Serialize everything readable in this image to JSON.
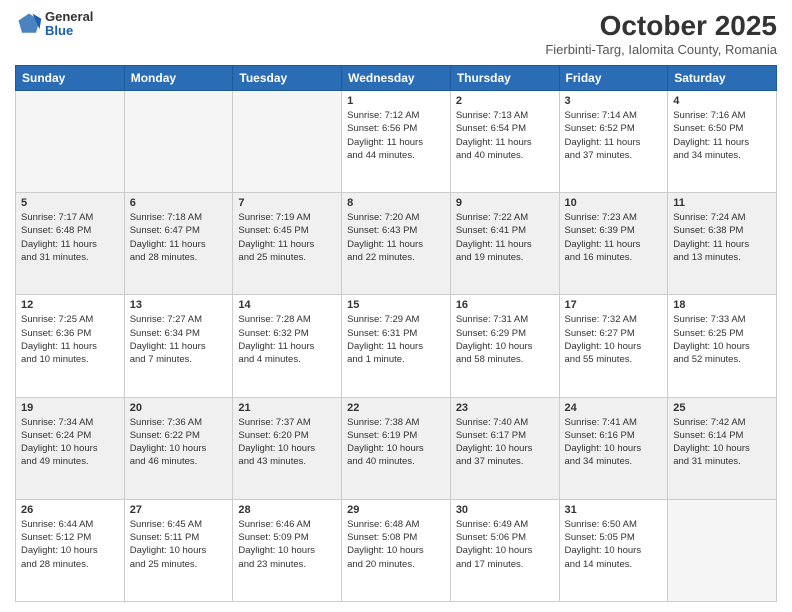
{
  "header": {
    "logo": {
      "line1": "General",
      "line2": "Blue"
    },
    "title": "October 2025",
    "location": "Fierbinti-Targ, Ialomita County, Romania"
  },
  "weekdays": [
    "Sunday",
    "Monday",
    "Tuesday",
    "Wednesday",
    "Thursday",
    "Friday",
    "Saturday"
  ],
  "rows": [
    {
      "shaded": false,
      "cells": [
        {
          "day": "",
          "info": ""
        },
        {
          "day": "",
          "info": ""
        },
        {
          "day": "",
          "info": ""
        },
        {
          "day": "1",
          "info": "Sunrise: 7:12 AM\nSunset: 6:56 PM\nDaylight: 11 hours\nand 44 minutes."
        },
        {
          "day": "2",
          "info": "Sunrise: 7:13 AM\nSunset: 6:54 PM\nDaylight: 11 hours\nand 40 minutes."
        },
        {
          "day": "3",
          "info": "Sunrise: 7:14 AM\nSunset: 6:52 PM\nDaylight: 11 hours\nand 37 minutes."
        },
        {
          "day": "4",
          "info": "Sunrise: 7:16 AM\nSunset: 6:50 PM\nDaylight: 11 hours\nand 34 minutes."
        }
      ]
    },
    {
      "shaded": true,
      "cells": [
        {
          "day": "5",
          "info": "Sunrise: 7:17 AM\nSunset: 6:48 PM\nDaylight: 11 hours\nand 31 minutes."
        },
        {
          "day": "6",
          "info": "Sunrise: 7:18 AM\nSunset: 6:47 PM\nDaylight: 11 hours\nand 28 minutes."
        },
        {
          "day": "7",
          "info": "Sunrise: 7:19 AM\nSunset: 6:45 PM\nDaylight: 11 hours\nand 25 minutes."
        },
        {
          "day": "8",
          "info": "Sunrise: 7:20 AM\nSunset: 6:43 PM\nDaylight: 11 hours\nand 22 minutes."
        },
        {
          "day": "9",
          "info": "Sunrise: 7:22 AM\nSunset: 6:41 PM\nDaylight: 11 hours\nand 19 minutes."
        },
        {
          "day": "10",
          "info": "Sunrise: 7:23 AM\nSunset: 6:39 PM\nDaylight: 11 hours\nand 16 minutes."
        },
        {
          "day": "11",
          "info": "Sunrise: 7:24 AM\nSunset: 6:38 PM\nDaylight: 11 hours\nand 13 minutes."
        }
      ]
    },
    {
      "shaded": false,
      "cells": [
        {
          "day": "12",
          "info": "Sunrise: 7:25 AM\nSunset: 6:36 PM\nDaylight: 11 hours\nand 10 minutes."
        },
        {
          "day": "13",
          "info": "Sunrise: 7:27 AM\nSunset: 6:34 PM\nDaylight: 11 hours\nand 7 minutes."
        },
        {
          "day": "14",
          "info": "Sunrise: 7:28 AM\nSunset: 6:32 PM\nDaylight: 11 hours\nand 4 minutes."
        },
        {
          "day": "15",
          "info": "Sunrise: 7:29 AM\nSunset: 6:31 PM\nDaylight: 11 hours\nand 1 minute."
        },
        {
          "day": "16",
          "info": "Sunrise: 7:31 AM\nSunset: 6:29 PM\nDaylight: 10 hours\nand 58 minutes."
        },
        {
          "day": "17",
          "info": "Sunrise: 7:32 AM\nSunset: 6:27 PM\nDaylight: 10 hours\nand 55 minutes."
        },
        {
          "day": "18",
          "info": "Sunrise: 7:33 AM\nSunset: 6:25 PM\nDaylight: 10 hours\nand 52 minutes."
        }
      ]
    },
    {
      "shaded": true,
      "cells": [
        {
          "day": "19",
          "info": "Sunrise: 7:34 AM\nSunset: 6:24 PM\nDaylight: 10 hours\nand 49 minutes."
        },
        {
          "day": "20",
          "info": "Sunrise: 7:36 AM\nSunset: 6:22 PM\nDaylight: 10 hours\nand 46 minutes."
        },
        {
          "day": "21",
          "info": "Sunrise: 7:37 AM\nSunset: 6:20 PM\nDaylight: 10 hours\nand 43 minutes."
        },
        {
          "day": "22",
          "info": "Sunrise: 7:38 AM\nSunset: 6:19 PM\nDaylight: 10 hours\nand 40 minutes."
        },
        {
          "day": "23",
          "info": "Sunrise: 7:40 AM\nSunset: 6:17 PM\nDaylight: 10 hours\nand 37 minutes."
        },
        {
          "day": "24",
          "info": "Sunrise: 7:41 AM\nSunset: 6:16 PM\nDaylight: 10 hours\nand 34 minutes."
        },
        {
          "day": "25",
          "info": "Sunrise: 7:42 AM\nSunset: 6:14 PM\nDaylight: 10 hours\nand 31 minutes."
        }
      ]
    },
    {
      "shaded": false,
      "cells": [
        {
          "day": "26",
          "info": "Sunrise: 6:44 AM\nSunset: 5:12 PM\nDaylight: 10 hours\nand 28 minutes."
        },
        {
          "day": "27",
          "info": "Sunrise: 6:45 AM\nSunset: 5:11 PM\nDaylight: 10 hours\nand 25 minutes."
        },
        {
          "day": "28",
          "info": "Sunrise: 6:46 AM\nSunset: 5:09 PM\nDaylight: 10 hours\nand 23 minutes."
        },
        {
          "day": "29",
          "info": "Sunrise: 6:48 AM\nSunset: 5:08 PM\nDaylight: 10 hours\nand 20 minutes."
        },
        {
          "day": "30",
          "info": "Sunrise: 6:49 AM\nSunset: 5:06 PM\nDaylight: 10 hours\nand 17 minutes."
        },
        {
          "day": "31",
          "info": "Sunrise: 6:50 AM\nSunset: 5:05 PM\nDaylight: 10 hours\nand 14 minutes."
        },
        {
          "day": "",
          "info": ""
        }
      ]
    }
  ]
}
